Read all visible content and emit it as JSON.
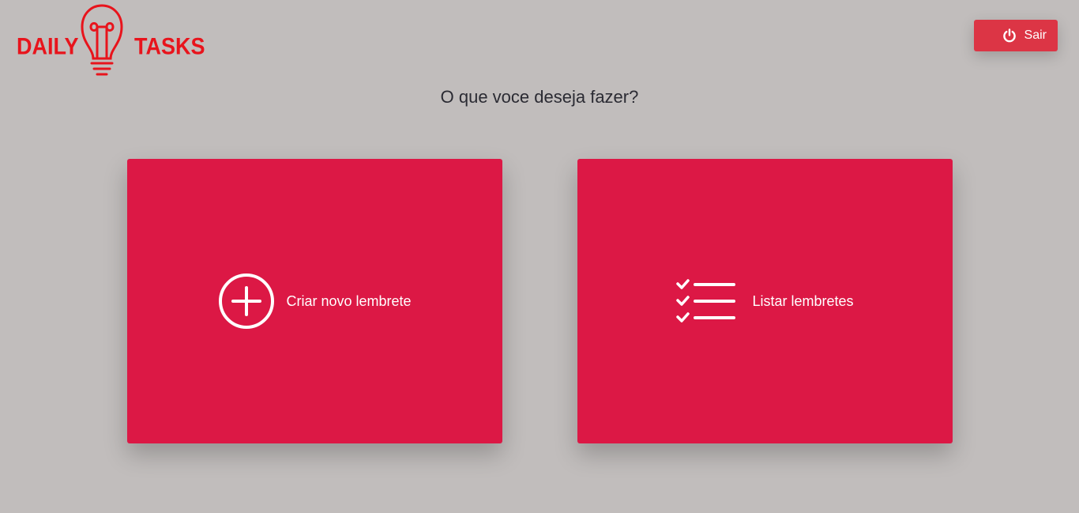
{
  "brand": {
    "word_left": "DAILY",
    "word_right": "TASKS",
    "color": "#e8141c"
  },
  "header": {
    "exit_label": "Sair",
    "exit_icon": "power-icon",
    "exit_color": "#dc3545"
  },
  "main": {
    "question": "O que voce deseja fazer?",
    "cards": [
      {
        "label": "Criar novo lembrete",
        "icon": "plus-circle-icon"
      },
      {
        "label": "Listar lembretes",
        "icon": "checklist-icon"
      }
    ],
    "card_color": "#dc1845"
  },
  "background_color": "#c1bdbc"
}
